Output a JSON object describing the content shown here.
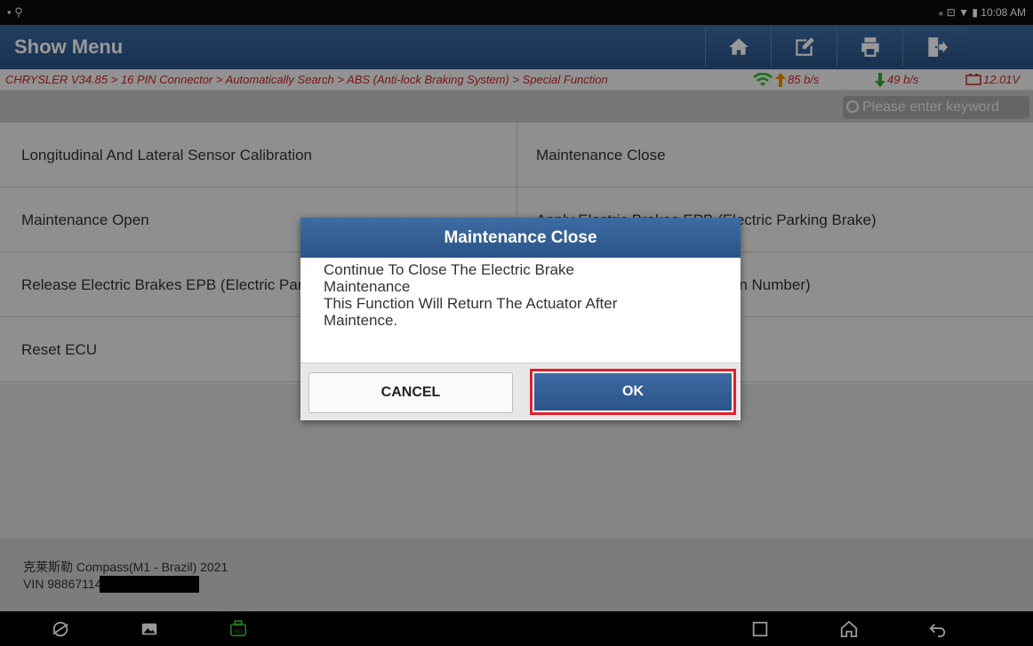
{
  "status_bar": {
    "left_icons": "▪ ⚲",
    "right_text": "⁎ ⊡ ▼ ▮ 10:08 AM"
  },
  "header": {
    "title": "Show Menu",
    "buttons": [
      "home-icon",
      "edit-icon",
      "print-icon",
      "exit-icon"
    ]
  },
  "breadcrumb": {
    "path": "CHRYSLER V34.85 > 16 PIN Connector > Automatically Search > ABS (Anti-lock Braking System) > Special Function",
    "upload_speed": "85 b/s",
    "download_speed": "49 b/s",
    "voltage": "12.01V"
  },
  "search": {
    "placeholder": "Please enter keyword"
  },
  "menu": {
    "items": [
      {
        "label": "Longitudinal And Lateral Sensor Calibration"
      },
      {
        "label": "Maintenance Close"
      },
      {
        "label": "Maintenance Open"
      },
      {
        "label": "Apply Electric Brakes EPB (Electric Parking Brake)"
      },
      {
        "label": "Release Electric Brakes EPB (Electric Parking Brake)"
      },
      {
        "label": "Write VIN (Vehicle Identification Number)"
      },
      {
        "label": "Reset ECU"
      }
    ]
  },
  "vehicle": {
    "model": "克莱斯勒 Compass(M1 - Brazil) 2021",
    "vin": "VIN 988671143NKN"
  },
  "dialog": {
    "title": "Maintenance Close",
    "line1": "Continue To Close The Electric Brake",
    "line2": "Maintenance",
    "line3": "This Function Will Return The Actuator After",
    "line4": "Maintence.",
    "cancel_label": "CANCEL",
    "ok_label": "OK"
  },
  "colors": {
    "header_blue": "#2c568b",
    "path_red": "#c8252b",
    "highlight_red": "#e3202a",
    "vci_green": "#3bbf3b"
  }
}
